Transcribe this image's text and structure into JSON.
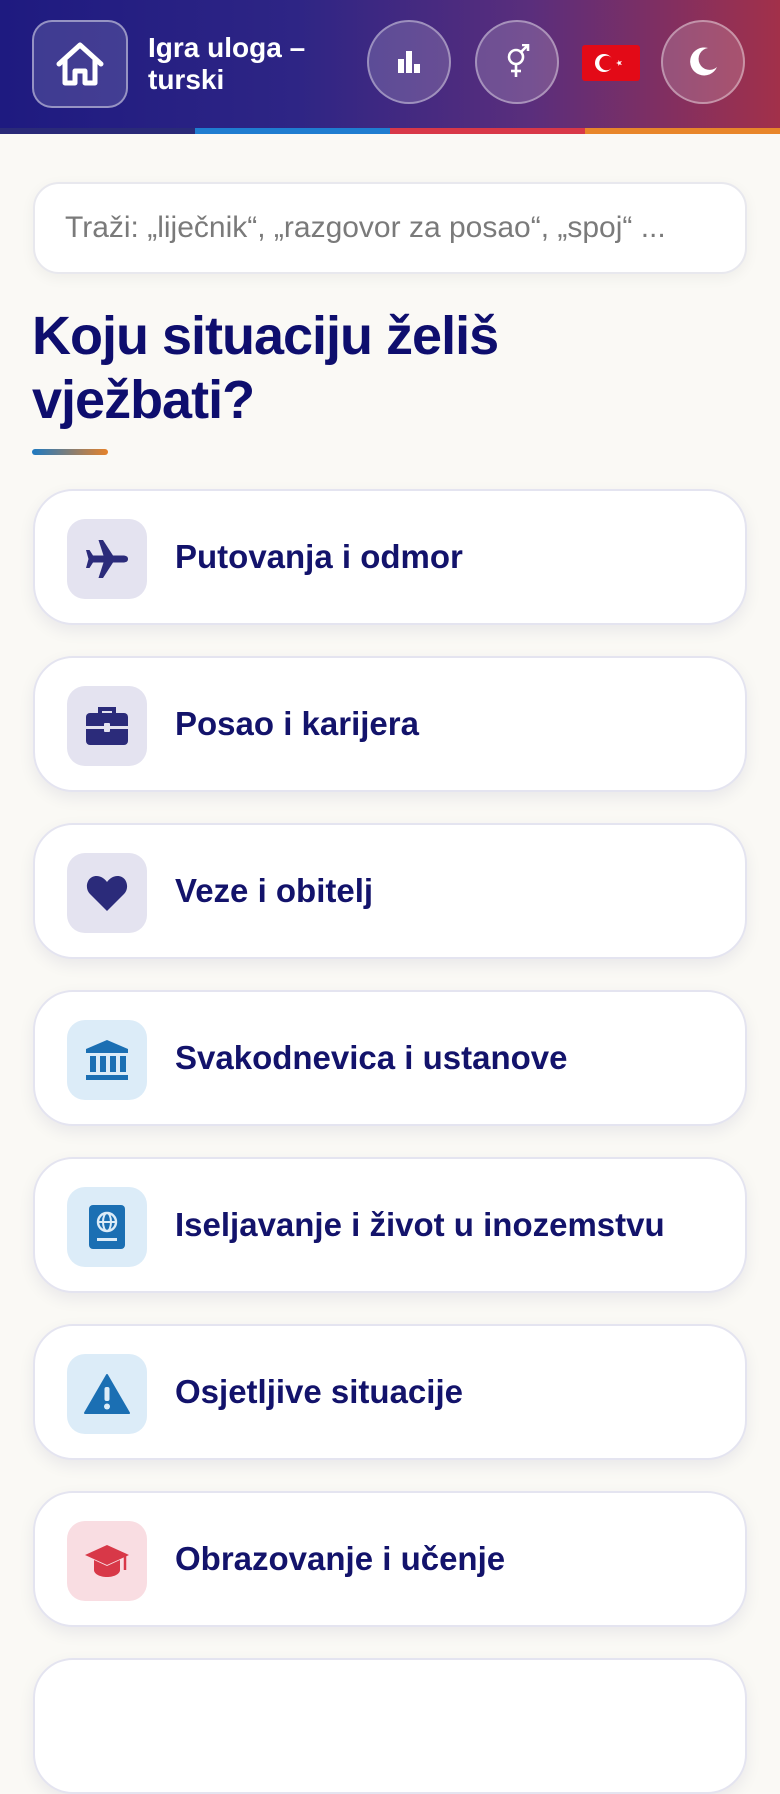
{
  "header": {
    "title": "Igra uloga – turski",
    "icons": [
      "home-icon",
      "stats-icon",
      "gender-icon",
      "turkey-flag-icon",
      "moon-icon"
    ],
    "stripe_colors": [
      "#2a2a78",
      "#1f7dd0",
      "#d83848",
      "#e8862a"
    ]
  },
  "search": {
    "placeholder": "Traži: „liječnik“, „razgovor za posao“, „spoj“ ..."
  },
  "main": {
    "heading": "Koju situaciju želiš vježbati?"
  },
  "categories": [
    {
      "label": "Putovanja i odmor",
      "icon": "airplane-icon",
      "icon_bg": "#e4e3f0",
      "icon_color": "#2b2b7a"
    },
    {
      "label": "Posao i karijera",
      "icon": "briefcase-icon",
      "icon_bg": "#e4e3f0",
      "icon_color": "#2b2b7a"
    },
    {
      "label": "Veze i obitelj",
      "icon": "heart-icon",
      "icon_bg": "#e4e3f0",
      "icon_color": "#2b2b7a"
    },
    {
      "label": "Svakodnevica i ustanove",
      "icon": "bank-icon",
      "icon_bg": "#dcecf8",
      "icon_color": "#1b6fb3"
    },
    {
      "label": "Iseljavanje i život u inozemstvu",
      "icon": "passport-icon",
      "icon_bg": "#dcecf8",
      "icon_color": "#1b6fb3"
    },
    {
      "label": "Osjetljive situacije",
      "icon": "warning-icon",
      "icon_bg": "#dcecf8",
      "icon_color": "#1b6fb3"
    },
    {
      "label": "Obrazovanje i učenje",
      "icon": "graduation-cap-icon",
      "icon_bg": "#f9dde2",
      "icon_color": "#d83848"
    }
  ]
}
